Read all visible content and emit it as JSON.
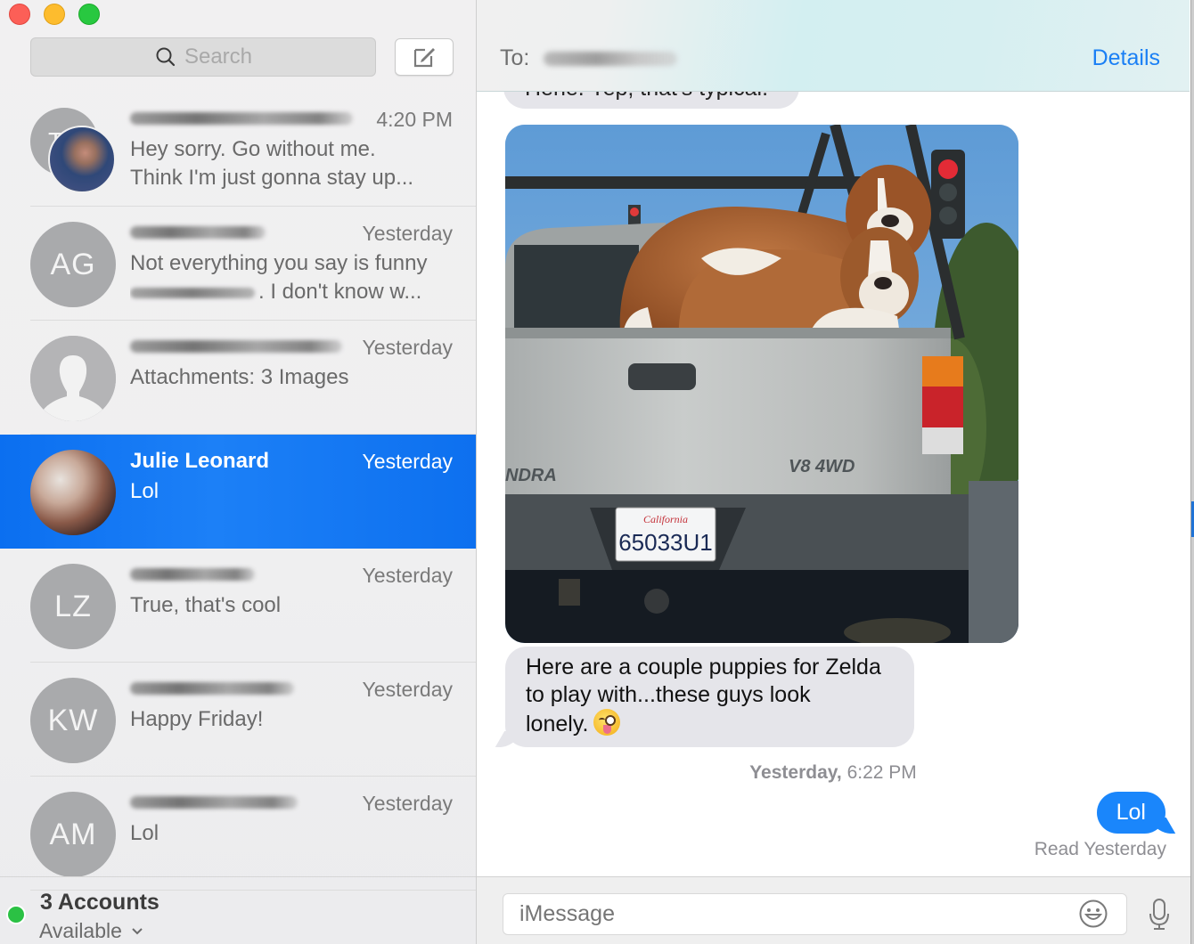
{
  "window": {
    "traffic_lights": [
      "close",
      "minimize",
      "maximize"
    ]
  },
  "sidebar": {
    "search": {
      "placeholder": "Search",
      "icon": "search-icon"
    },
    "compose_icon": "compose-icon",
    "conversations": [
      {
        "avatar_type": "group",
        "initials": "T",
        "name": "",
        "name_redacted": true,
        "time": "4:20 PM",
        "preview": "Hey sorry. Go without me. Think I'm just gonna stay up...",
        "preview_lines": [
          "Hey sorry. Go without me.",
          "Think I'm just gonna stay up..."
        ],
        "selected": false
      },
      {
        "avatar_type": "initials",
        "initials": "AG",
        "name": "",
        "name_redacted": true,
        "time": "Yesterday",
        "preview_lines": [
          "Not everything you say is funny",
          ". I don't know w..."
        ],
        "selected": false
      },
      {
        "avatar_type": "silhouette",
        "initials": "",
        "name": "",
        "name_redacted": true,
        "time": "Yesterday",
        "preview_lines": [
          "Attachments: 3 Images"
        ],
        "selected": false
      },
      {
        "avatar_type": "photo",
        "initials": "",
        "name": "Julie Leonard",
        "name_redacted": false,
        "time": "Yesterday",
        "preview_lines": [
          "Lol"
        ],
        "selected": true
      },
      {
        "avatar_type": "initials",
        "initials": "LZ",
        "name": "",
        "name_redacted": true,
        "time": "Yesterday",
        "preview_lines": [
          "True, that's cool"
        ],
        "selected": false
      },
      {
        "avatar_type": "initials",
        "initials": "KW",
        "name": "",
        "name_redacted": true,
        "time": "Yesterday",
        "preview_lines": [
          "Happy Friday!"
        ],
        "selected": false
      },
      {
        "avatar_type": "initials",
        "initials": "AM",
        "name": "",
        "name_redacted": true,
        "time": "Yesterday",
        "preview_lines": [
          "Lol"
        ],
        "selected": false
      }
    ],
    "accounts": {
      "title": "3 Accounts",
      "status": "Available",
      "status_color": "#2bc144"
    }
  },
  "chat": {
    "header": {
      "to_label": "To:",
      "recipient_redacted": true,
      "details_label": "Details"
    },
    "messages": [
      {
        "direction": "incoming",
        "type": "text",
        "text": "Hene. Yep, that's typical.",
        "partially_hidden": true
      },
      {
        "direction": "incoming",
        "type": "image",
        "description": "Two Saint Bernard dogs in the bed of a silver pickup truck",
        "plate_text": "65033U1",
        "plate_state": "California",
        "badge_text": "V8 4WD",
        "model_text": "NDRA"
      },
      {
        "direction": "incoming",
        "type": "text",
        "text": "Here are a couple puppies for Zelda to play with...these guys look lonely.",
        "lines": [
          "Here are a couple puppies for Zelda",
          "to play with...these guys look",
          "lonely."
        ],
        "emoji": "winking-face-with-tongue"
      },
      {
        "type": "timestamp",
        "day": "Yesterday,",
        "time": "6:22 PM"
      },
      {
        "direction": "outgoing",
        "type": "text",
        "text": "Lol",
        "receipt": "Read Yesterday"
      }
    ],
    "input": {
      "placeholder": "iMessage"
    },
    "colors": {
      "accent": "#1a7ff5",
      "outgoing_bubble": "#1a86fb",
      "incoming_bubble": "#e5e5ea",
      "selection": "#1576f2"
    }
  }
}
